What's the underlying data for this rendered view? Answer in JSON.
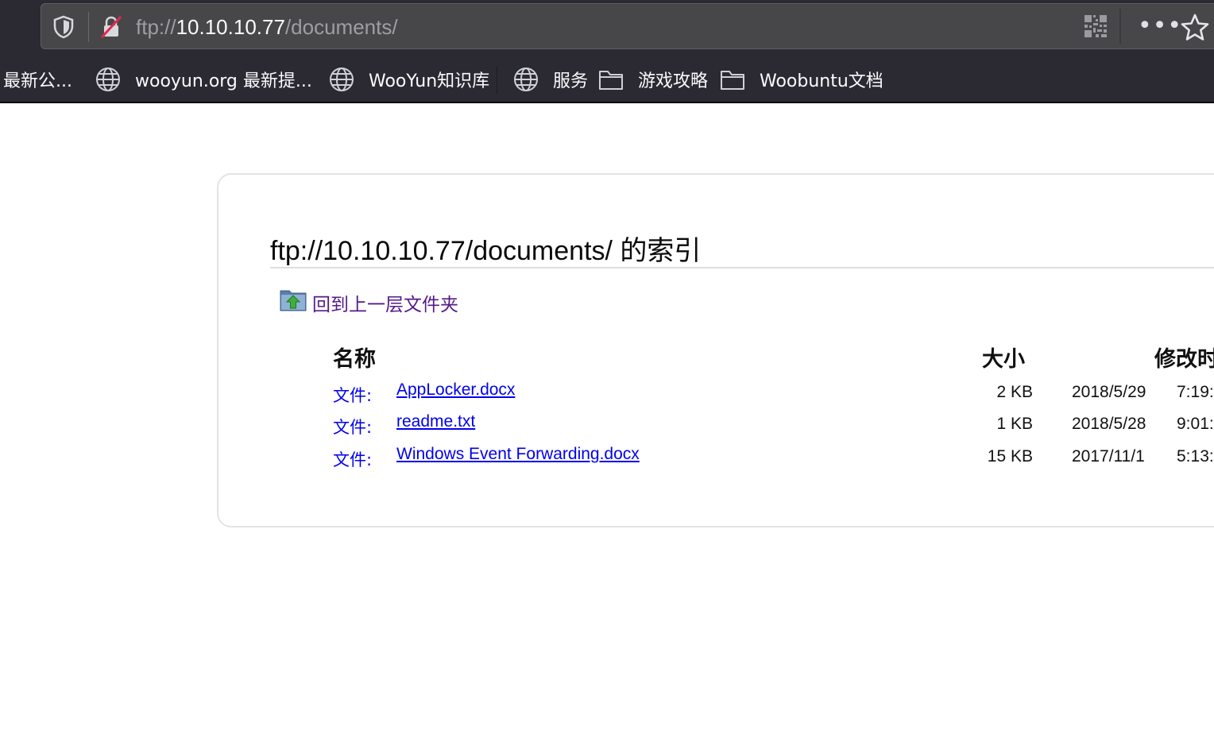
{
  "browser": {
    "url_scheme": "ftp://",
    "url_host": "10.10.10.77",
    "url_path": "/documents/",
    "more_menu_label": "•••"
  },
  "bookmarks": [
    {
      "label": "最新公...",
      "icon": "none"
    },
    {
      "label": "wooyun.org 最新提...",
      "icon": "globe-icon"
    },
    {
      "label": "WooYun知识库",
      "icon": "globe-icon"
    },
    {
      "label": "服务",
      "icon": "globe-icon"
    },
    {
      "label": "游戏攻略",
      "icon": "folder-icon"
    },
    {
      "label": "Woobuntu文档",
      "icon": "folder-icon"
    }
  ],
  "page": {
    "title": "ftp://10.10.10.77/documents/ 的索引",
    "up_link": "回到上一层文件夹",
    "columns": {
      "name": "名称",
      "size": "大小",
      "modified": "修改时"
    },
    "files": [
      {
        "kind": "文件:",
        "name": "AppLocker.docx",
        "size": "2 KB",
        "date": "2018/5/29",
        "time": "7:19:"
      },
      {
        "kind": "文件:",
        "name": "readme.txt",
        "size": "1 KB",
        "date": "2018/5/28",
        "time": "9:01:"
      },
      {
        "kind": "文件:",
        "name": "Windows Event Forwarding.docx",
        "size": "15 KB",
        "date": "2017/11/1",
        "time": "5:13:"
      }
    ]
  },
  "colors": {
    "chrome_bg": "#2b2a33",
    "urlbar_bg": "#474749",
    "link": "#0000ee",
    "visited_link": "#551a8b"
  }
}
